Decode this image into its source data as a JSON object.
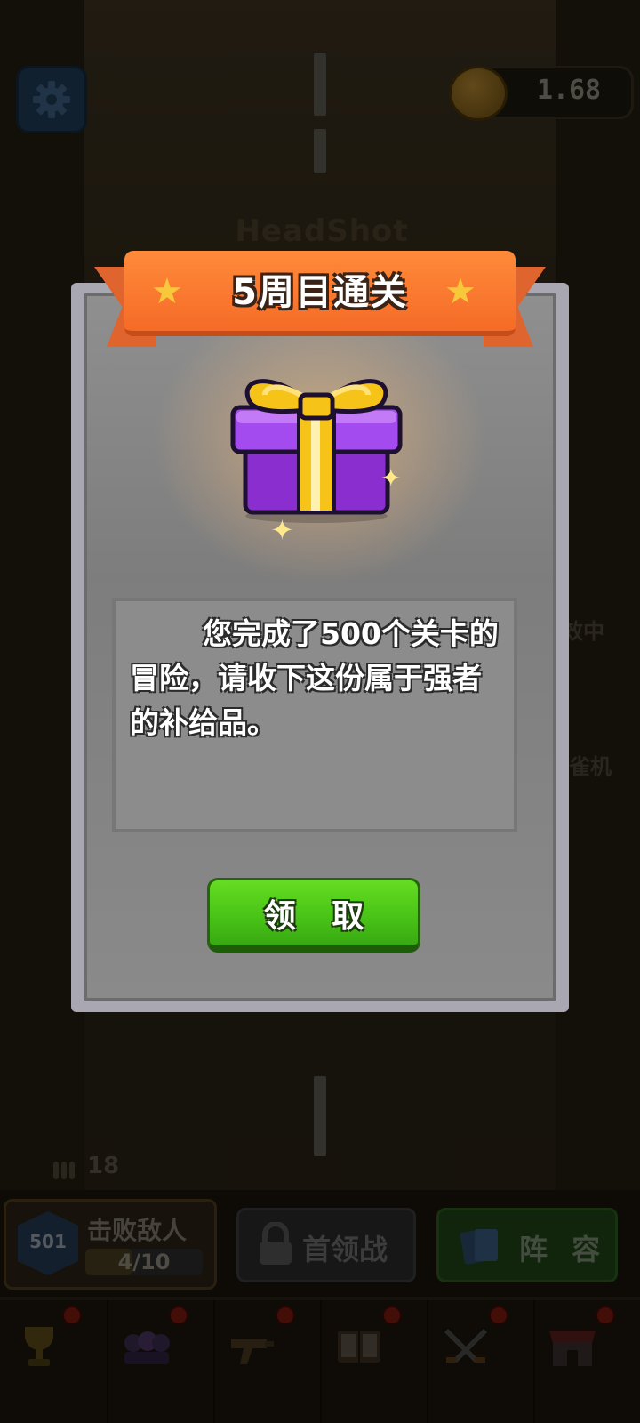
{
  "hud": {
    "coins": "1.68",
    "headshot_text": "HeadShot",
    "settings_icon": "gear-icon",
    "coin_icon": "coin-icon"
  },
  "dialog": {
    "title": "5周目通关",
    "description": "您完成了500个关卡的冒险，请收下这份属于强者的补给品。",
    "reward_icon": "gift-box-icon",
    "claim_label": "领 取"
  },
  "side_buttons": {
    "effect_label": "效中",
    "machine_label": "雀机"
  },
  "bottom_hud": {
    "ammo": "18",
    "level": "501",
    "enemy_task_label": "击败敌人",
    "enemy_progress": "4/10",
    "enemy_progress_fraction": 0.4,
    "boss_label": "首领战",
    "lineup_label": "阵 容"
  },
  "nav": [
    {
      "icon": "trophy-icon"
    },
    {
      "icon": "heroes-icon"
    },
    {
      "icon": "gun-icon"
    },
    {
      "icon": "book-icon"
    },
    {
      "icon": "crossed-swords-icon"
    },
    {
      "icon": "shop-icon"
    }
  ],
  "colors": {
    "banner": "#f56b27",
    "claim_button": "#49c417",
    "gift_box": "#9b3fe0",
    "gift_ribbon": "#f6c319"
  }
}
